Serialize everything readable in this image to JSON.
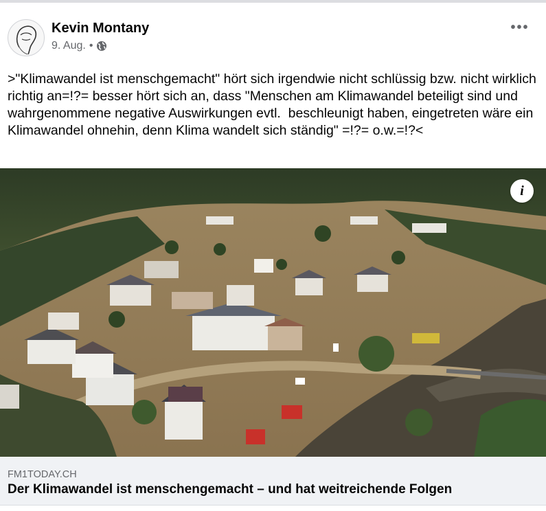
{
  "post": {
    "author_name": "Kevin Montany",
    "date": "9. Aug.",
    "separator": "•",
    "audience_icon": "globe-icon",
    "more_icon": "more-options-icon",
    "more_label": "•••",
    "text": ">\"Klimawandel ist menschgemacht\" hört sich irgendwie nicht schlüssig bzw. nicht wirklich richtig an=!?= besser hört sich an, dass \"Menschen am Klimawandel beteiligt sind und wahrgenommene negative Auswirkungen evtl.  beschleunigt haben, eingetreten wäre ein Klimawandel ohnehin, denn Klima wandelt sich ständig\" =!?= o.w.=!?<"
  },
  "link_preview": {
    "info_label": "i",
    "domain": "FM1TODAY.CH",
    "title": "Der Klimawandel ist menschengemacht – und hat weitreichende Folgen"
  },
  "colors": {
    "secondary_text": "#65676b",
    "footer_background": "#f0f2f5",
    "primary_text": "#050505"
  }
}
